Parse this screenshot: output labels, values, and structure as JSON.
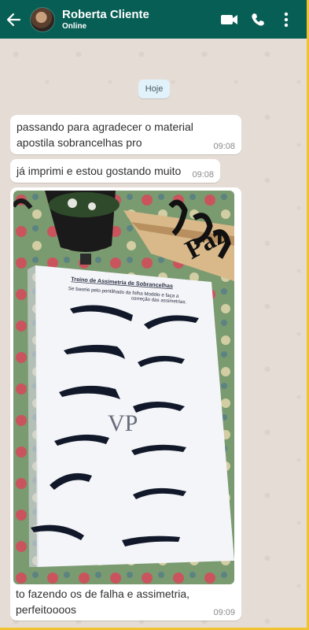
{
  "header": {
    "contact_name": "Roberta Cliente",
    "contact_status": "Online",
    "icons": [
      "back-arrow-icon",
      "video-call-icon",
      "phone-icon",
      "more-vertical-icon"
    ],
    "bg_color": "#075e54"
  },
  "chat": {
    "date_chip": "Hoje",
    "messages": [
      {
        "text": "passando para agradecer o material apostila sobrancelhas pro",
        "time": "09:08"
      },
      {
        "text": "já imprimi e estou gostando muito",
        "time": "09:08"
      },
      {
        "text": "to fazendo os de falha e assimetria, perfeitoooos",
        "time": "09:09",
        "image": {
          "sheet_title": "Treino de Assimetria de Sobrancelhas",
          "sheet_subtitle_1": "Se baseie pelo pontilhado da folha Modelo e faça a",
          "sheet_subtitle_2": "correção das assimetrias.",
          "sheet_logo": "VP",
          "decor_text": "Paz"
        }
      }
    ]
  }
}
